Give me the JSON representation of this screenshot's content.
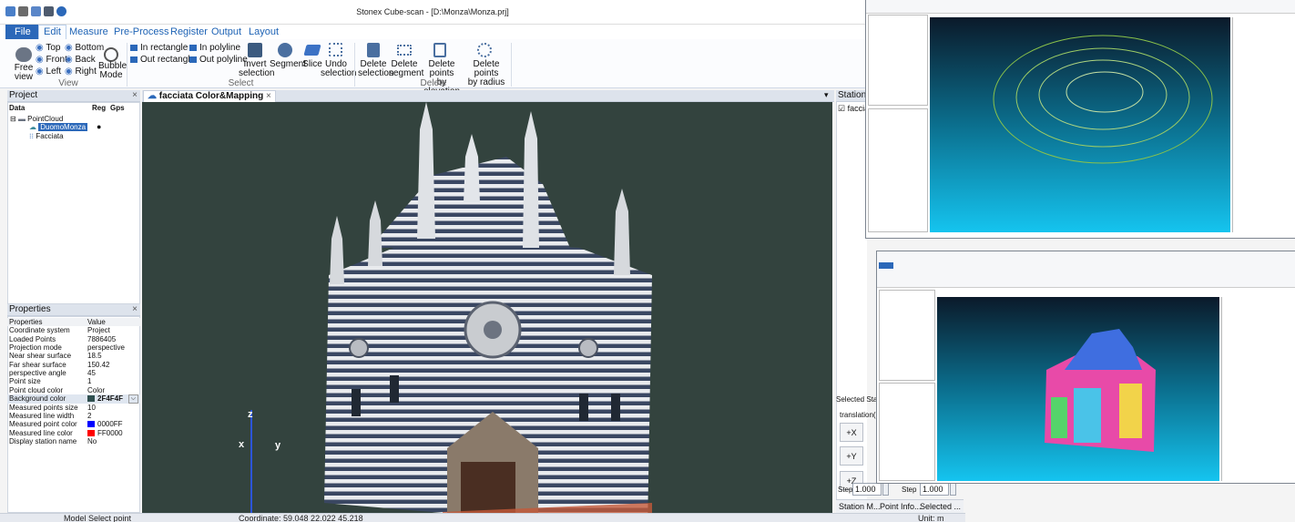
{
  "window": {
    "title": "Stonex Cube-scan - [D:\\Monza\\Monza.prj]"
  },
  "menu": {
    "file": "File",
    "edit": "Edit",
    "measure": "Measure",
    "preprocess": "Pre-Process",
    "register": "Register",
    "output": "Output",
    "layout": "Layout"
  },
  "ribbon": {
    "view": {
      "top": "Top",
      "bottom": "Bottom",
      "front": "Front",
      "back": "Back",
      "left": "Left",
      "right": "Right",
      "free": "Free",
      "view_word": "view",
      "bubble": "Bubble",
      "mode": "Mode",
      "group": "View"
    },
    "select": {
      "in_rectangle": "In rectangle",
      "out_rectangle": "Out rectangle",
      "in_polyline": "In polyline",
      "out_polyline": "Out polyline",
      "invert": "Invert",
      "selection": "selection",
      "segment": "Segment",
      "slice": "Slice",
      "undo": "Undo",
      "undo_sel": "selection",
      "group": "Select"
    },
    "delete": {
      "delete1": "Delete",
      "delete1b": "selection",
      "delete2": "Delete",
      "delete2b": "segment",
      "delete3": "Delete points",
      "delete3b": "by elevation",
      "delete4": "Delete points",
      "delete4b": "by radius",
      "group": "Delete"
    }
  },
  "project": {
    "title": "Project",
    "col_data": "Data",
    "col_reg": "Reg",
    "col_gps": "Gps",
    "root": "PointCloud",
    "item1": "DuomoMonza",
    "item2": "Facciata"
  },
  "properties": {
    "title": "Properties",
    "header": [
      "Properties",
      "Value"
    ],
    "rows": [
      [
        "Coordinate system",
        "Project"
      ],
      [
        "Loaded Points",
        "7886405"
      ],
      [
        "Projection mode",
        "perspective"
      ],
      [
        "Near shear surface",
        "18.5"
      ],
      [
        "Far shear surface",
        "150.42"
      ],
      [
        "perspective angle",
        "45"
      ],
      [
        "Point size",
        "1"
      ],
      [
        "Point cloud color",
        "Color"
      ],
      [
        "Background color",
        "2F4F4F"
      ],
      [
        "Measured points size",
        "10"
      ],
      [
        "Measured line width",
        "2"
      ],
      [
        "Measured point color",
        "0000FF"
      ],
      [
        "Measured line color",
        "FF0000"
      ],
      [
        "Display station name",
        "No"
      ]
    ]
  },
  "tabs": {
    "viewport_tab": "facciata Color&Mapping"
  },
  "station": {
    "title": "Station M",
    "item": "faccia",
    "selected": "Selected Station:",
    "translation": "translation(m)",
    "px": "+X",
    "py": "+Y",
    "pz": "+Z",
    "step_label1": "Step",
    "step_value1": "1.000",
    "step_label2": "Step",
    "step_value2": "1.000",
    "tab1": "Station M...",
    "tab2": "Point Info...",
    "tab3": "Selected ..."
  },
  "status": {
    "mode": "Model Select point",
    "coordinate": "Coordinate: 59.048 22.022 45.218",
    "unit": "Unit: m"
  },
  "axes": {
    "x": "x",
    "y": "y",
    "z": "z"
  },
  "colors": {
    "background": "#2F4F4F",
    "measured_point": "#0000FF",
    "measured_line": "#FF0000",
    "accent": "#2B68B9"
  }
}
